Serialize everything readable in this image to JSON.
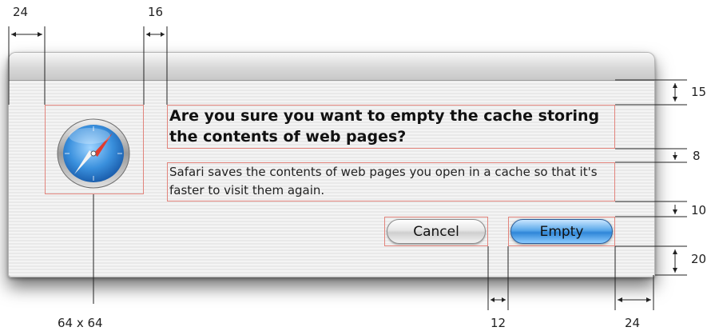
{
  "dialog": {
    "heading": "Are you sure you want to empty the cache storing the contents of web pages?",
    "message": "Safari saves the contents of web pages you open in a cache so that it's faster to visit them again.",
    "cancel_label": "Cancel",
    "empty_label": "Empty",
    "icon": "safari-compass-icon"
  },
  "dimensions": {
    "left_margin": "24",
    "icon_gap": "16",
    "icon_size": "64 x 64",
    "button_gap": "12",
    "right_margin": "24",
    "top_spacing": "15",
    "heading_body_spacing": "8",
    "body_button_spacing": "10",
    "bottom_spacing": "20"
  },
  "colors": {
    "spec_box": "#e2847c",
    "default_button": "#3a8fdc"
  }
}
